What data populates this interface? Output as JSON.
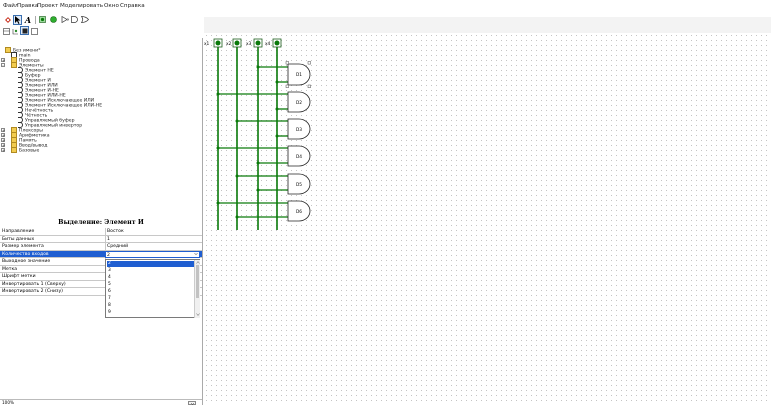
{
  "menu": [
    "Файл",
    "Правка",
    "Проект",
    "Моделировать",
    "Окно",
    "Справка"
  ],
  "toolbar": {
    "tools": [
      "pan-tool",
      "select-tool",
      "text-tool",
      "input-pin",
      "output-pin",
      "not-gate",
      "and-gate",
      "or-gate"
    ],
    "text_tool_glyph": "A"
  },
  "tree": {
    "items": [
      {
        "label": "Без имени*",
        "level": 0,
        "kind": "project"
      },
      {
        "label": "main",
        "level": 1,
        "kind": "circuit"
      },
      {
        "label": "Провода",
        "level": 1,
        "kind": "folder",
        "expander": "+"
      },
      {
        "label": "Элементы",
        "level": 1,
        "kind": "folder",
        "expander": "-"
      },
      {
        "label": "Элемент НЕ",
        "level": 2,
        "kind": "gate"
      },
      {
        "label": "Буфер",
        "level": 2,
        "kind": "gate"
      },
      {
        "label": "Элемент И",
        "level": 2,
        "kind": "gate"
      },
      {
        "label": "Элемент ИЛИ",
        "level": 2,
        "kind": "gate"
      },
      {
        "label": "Элемент И-НЕ",
        "level": 2,
        "kind": "gate"
      },
      {
        "label": "Элемент ИЛИ-НЕ",
        "level": 2,
        "kind": "gate"
      },
      {
        "label": "Элемент Исключающее ИЛИ",
        "level": 2,
        "kind": "gate"
      },
      {
        "label": "Элемент Исключающее ИЛИ-НЕ",
        "level": 2,
        "kind": "gate"
      },
      {
        "label": "Нечётность",
        "level": 2,
        "kind": "gate"
      },
      {
        "label": "Чётность",
        "level": 2,
        "kind": "gate"
      },
      {
        "label": "Управляемый буфер",
        "level": 2,
        "kind": "gate"
      },
      {
        "label": "Управляемый инвертор",
        "level": 2,
        "kind": "gate"
      },
      {
        "label": "Плексоры",
        "level": 1,
        "kind": "folder",
        "expander": "+"
      },
      {
        "label": "Арифметика",
        "level": 1,
        "kind": "folder",
        "expander": "+"
      },
      {
        "label": "Память",
        "level": 1,
        "kind": "folder",
        "expander": "+"
      },
      {
        "label": "Ввод/вывод",
        "level": 1,
        "kind": "folder",
        "expander": "+"
      },
      {
        "label": "Базовые",
        "level": 1,
        "kind": "folder",
        "expander": "+"
      }
    ]
  },
  "attributes": {
    "header": "Выделение: Элемент И",
    "rows": [
      {
        "key": "Направление",
        "value": "Восток"
      },
      {
        "key": "Биты данных",
        "value": "1"
      },
      {
        "key": "Размер элемента",
        "value": "Средний"
      },
      {
        "key": "Количество входов",
        "value": "2",
        "highlighted": true
      },
      {
        "key": "Выходное значение",
        "value": ""
      },
      {
        "key": "Метка",
        "value": ""
      },
      {
        "key": "Шрифт метки",
        "value": ""
      },
      {
        "key": "Инвертировать 1 (Сверху)",
        "value": ""
      },
      {
        "key": "Инвертировать 2 (Снизу)",
        "value": ""
      }
    ],
    "dropdown_options": [
      "2",
      "3",
      "4",
      "5",
      "6",
      "7",
      "8",
      "9"
    ],
    "dropdown_selected": "2"
  },
  "statusbar": {
    "zoom": "100%"
  },
  "circuit": {
    "inputs": [
      "x1",
      "x2",
      "x3",
      "x4"
    ],
    "gates": [
      "D1",
      "D2",
      "D3",
      "D4",
      "D5",
      "D6"
    ]
  },
  "colors": {
    "wire": "#0a7a0a",
    "selection": "#1f5ed1",
    "folder": "#f2cc4f"
  }
}
